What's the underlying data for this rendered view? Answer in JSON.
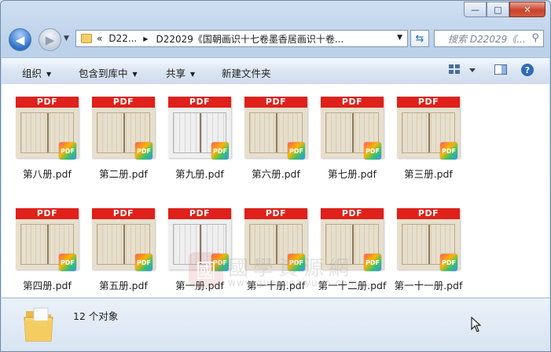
{
  "window": {
    "controls": {
      "minimize": "—",
      "maximize": "□",
      "close": "✕"
    }
  },
  "nav": {
    "back_icon": "arrow-left-icon",
    "forward_icon": "arrow-right-icon",
    "breadcrumb": [
      "«",
      "D22...",
      "D22029《国朝画识十七卷墨香居画识十卷..."
    ],
    "search_placeholder": "搜索 D22029《..."
  },
  "toolbar": {
    "organize": "组织",
    "include_in_library": "包含到库中",
    "share": "共享",
    "new_folder": "新建文件夹"
  },
  "files": [
    {
      "name": "第八册.pdf",
      "thumb_label": "PDF",
      "style": "normal"
    },
    {
      "name": "第二册.pdf",
      "thumb_label": "PDF",
      "style": "normal"
    },
    {
      "name": "第九册.pdf",
      "thumb_label": "PDF",
      "style": "light"
    },
    {
      "name": "第六册.pdf",
      "thumb_label": "PDF",
      "style": "normal"
    },
    {
      "name": "第七册.pdf",
      "thumb_label": "PDF",
      "style": "normal"
    },
    {
      "name": "第三册.pdf",
      "thumb_label": "PDF",
      "style": "normal"
    },
    {
      "name": "第四册.pdf",
      "thumb_label": "PDF",
      "style": "normal"
    },
    {
      "name": "第五册.pdf",
      "thumb_label": "PDF",
      "style": "normal"
    },
    {
      "name": "第一册.pdf",
      "thumb_label": "PDF",
      "style": "light"
    },
    {
      "name": "第一十册.pdf",
      "thumb_label": "PDF",
      "style": "normal"
    },
    {
      "name": "第一十二册.pdf",
      "thumb_label": "PDF",
      "style": "normal"
    },
    {
      "name": "第一十一册.pdf",
      "thumb_label": "PDF",
      "style": "normal"
    }
  ],
  "badge_text": "PDF",
  "watermark": {
    "logo": "國",
    "chinese": "國學資源網",
    "url": "www.guoxueziyuan.com"
  },
  "details": {
    "count": "12 个对象"
  }
}
